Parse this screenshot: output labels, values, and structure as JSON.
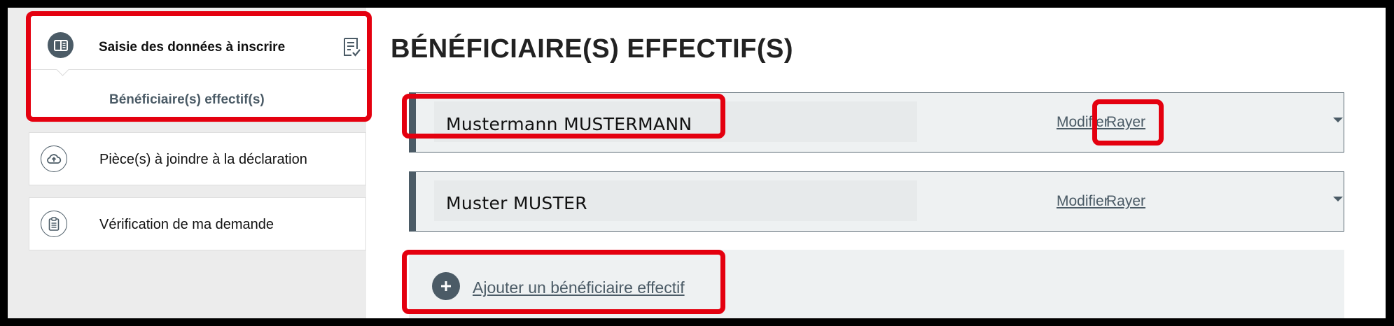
{
  "sidebar": {
    "active_step": {
      "title": "Saisie des données à inscrire",
      "sub_item": "Bénéficiaire(s) effectif(s)",
      "icon": "form-icon",
      "status_icon": "checklist-icon"
    },
    "steps": [
      {
        "label": "Pièce(s) à joindre à la déclaration",
        "icon": "cloud-upload-icon"
      },
      {
        "label": "Vérification de ma demande",
        "icon": "clipboard-icon"
      }
    ]
  },
  "main": {
    "page_title": "BÉNÉFICIAIRE(S) EFFECTIF(S)",
    "beneficiaries": [
      {
        "name": "Mustermann MUSTERMANN",
        "modify_label": "Modifier",
        "strike_label": "Rayer"
      },
      {
        "name": "Muster MUSTER",
        "modify_label": "Modifier",
        "strike_label": "Rayer"
      }
    ],
    "add_label": "Ajouter un bénéficiaire effectif"
  },
  "colors": {
    "accent": "#4b5b66",
    "highlight": "#e4000f",
    "card_bg": "#eef1f2"
  }
}
